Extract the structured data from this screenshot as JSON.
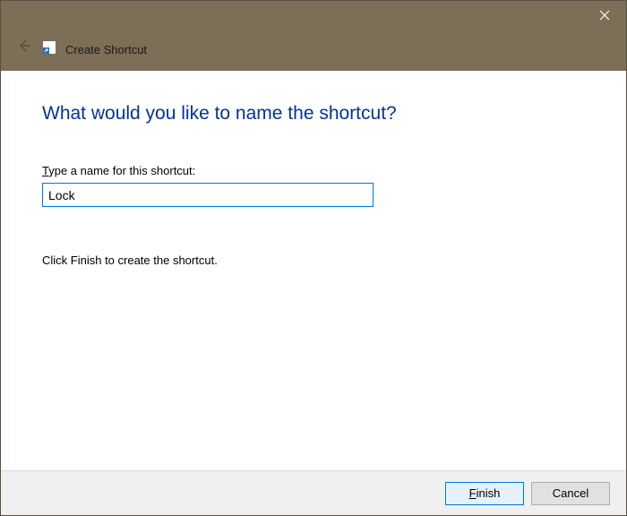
{
  "titlebar": {
    "title": "Create Shortcut"
  },
  "main": {
    "heading": "What would you like to name the shortcut?",
    "field_label_prefix": "T",
    "field_label_rest": "ype a name for this shortcut:",
    "input_value": "Lock",
    "instruction": "Click Finish to create the shortcut."
  },
  "footer": {
    "finish_prefix": "F",
    "finish_rest": "inish",
    "cancel_label": "Cancel"
  }
}
